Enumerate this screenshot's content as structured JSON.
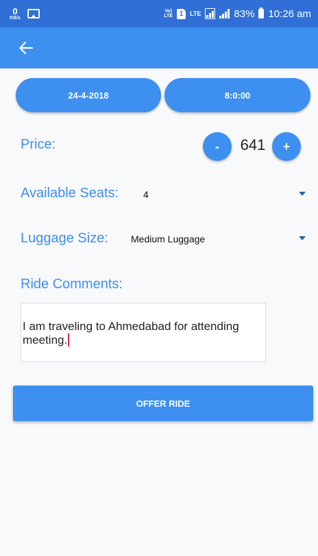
{
  "status_bar": {
    "net_speed_value": "0",
    "net_speed_unit": "KB/s",
    "volte_top": "Vo)",
    "volte_bottom": "LTE",
    "sim_label": "1",
    "lte_label": "LTE",
    "battery": "83%",
    "time": "10:26 am"
  },
  "app_bar": {
    "back_icon": "arrow-left-icon"
  },
  "schedule": {
    "date": "24-4-2018",
    "time": "8:0:00"
  },
  "price": {
    "label": "Price:",
    "decrement_label": "-",
    "value": "641",
    "increment_label": "+"
  },
  "seats": {
    "label": "Available Seats:",
    "selected": "4"
  },
  "luggage": {
    "label": "Luggage Size:",
    "selected": "Medium Luggage"
  },
  "comments": {
    "label": "Ride Comments:",
    "value": "I am traveling to Ahmedabad for attending meeting."
  },
  "actions": {
    "offer_label": "OFFER RIDE"
  },
  "colors": {
    "status_bar": "#2f6fd6",
    "primary": "#3d8ff0",
    "background": "#f8f9fb",
    "cursor": "#e0265a"
  }
}
